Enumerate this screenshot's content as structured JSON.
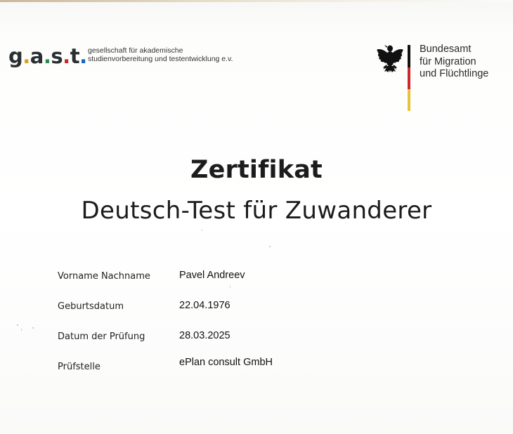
{
  "header": {
    "gast_logo": {
      "mark": {
        "g": "g",
        "a": "a",
        "s": "s",
        "t": "t",
        "dot": "."
      },
      "line1": "gesellschaft für akademische",
      "line2": "studienvorbereitung und testentwicklung e.v."
    },
    "bamf_logo": {
      "line1": "Bundesamt",
      "line2": "für Migration",
      "line3": "und Flüchtlinge"
    }
  },
  "certificate": {
    "title": "Zertifikat",
    "subtitle": "Deutsch-Test für Zuwanderer"
  },
  "fields": [
    {
      "label": "Vorname Nachname",
      "value": "Pavel Andreev"
    },
    {
      "label": "Geburtsdatum",
      "value": "22.04.1976"
    },
    {
      "label": "Datum der Prüfung",
      "value": "28.03.2025"
    },
    {
      "label": "Prüfstelle",
      "value": "ePlan consult GmbH"
    }
  ],
  "colors": {
    "gast_dots": [
      "#d6a11c",
      "#2d8a4e",
      "#c62828",
      "#1565c0"
    ],
    "flag": [
      "#111111",
      "#cc2a2a",
      "#e8c23a"
    ]
  }
}
